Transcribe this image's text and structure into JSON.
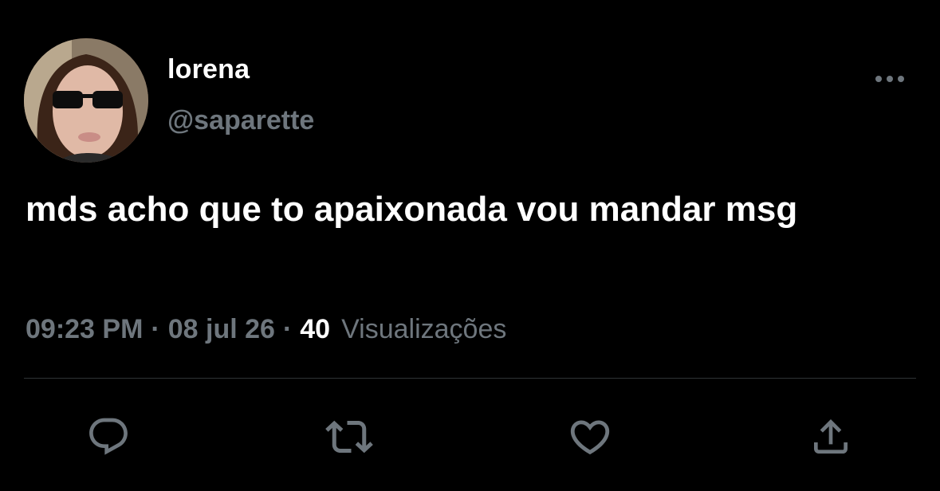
{
  "user": {
    "display_name": "lorena",
    "handle": "@saparette",
    "avatar": "profile-photo-avatar"
  },
  "tweet": {
    "text": "mds acho que to apaixonada vou mandar msg"
  },
  "meta": {
    "time": "09:23 PM",
    "separator": "·",
    "date": "08 jul 26",
    "views_count": "40",
    "views_label": "Visualizações"
  },
  "actions": [
    {
      "icon": "reply-icon"
    },
    {
      "icon": "retweet-icon"
    },
    {
      "icon": "like-icon"
    },
    {
      "icon": "share-icon"
    }
  ],
  "colors": {
    "background": "#000000",
    "text_primary": "#ffffff",
    "text_secondary": "#6e767d",
    "divider": "#2f3336"
  }
}
